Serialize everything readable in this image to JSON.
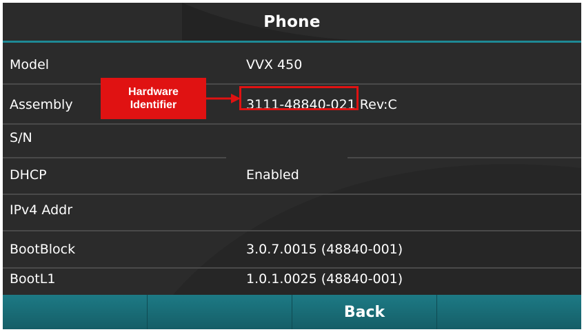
{
  "header": {
    "title": "Phone"
  },
  "rows": [
    {
      "label": "Model",
      "value": "VVX 450"
    },
    {
      "label": "Assembly",
      "value": "3111-48840-021 Rev:C"
    },
    {
      "label": "S/N",
      "value": ""
    },
    {
      "label": "DHCP",
      "value": "Enabled"
    },
    {
      "label": "IPv4 Addr",
      "value": ""
    },
    {
      "label": "BootBlock",
      "value": "3.0.7.0015 (48840-001)"
    },
    {
      "label": "BootL1",
      "value": "1.0.1.0025 (48840-001)"
    }
  ],
  "softkeys": [
    "",
    "",
    "Back",
    ""
  ],
  "annotation": {
    "line1": "Hardware",
    "line2": "Identifier",
    "color": "#e01212"
  },
  "colors": {
    "background": "#2b2b2b",
    "accent": "#1e8a96",
    "softkey_bar": "#1d7a85"
  }
}
